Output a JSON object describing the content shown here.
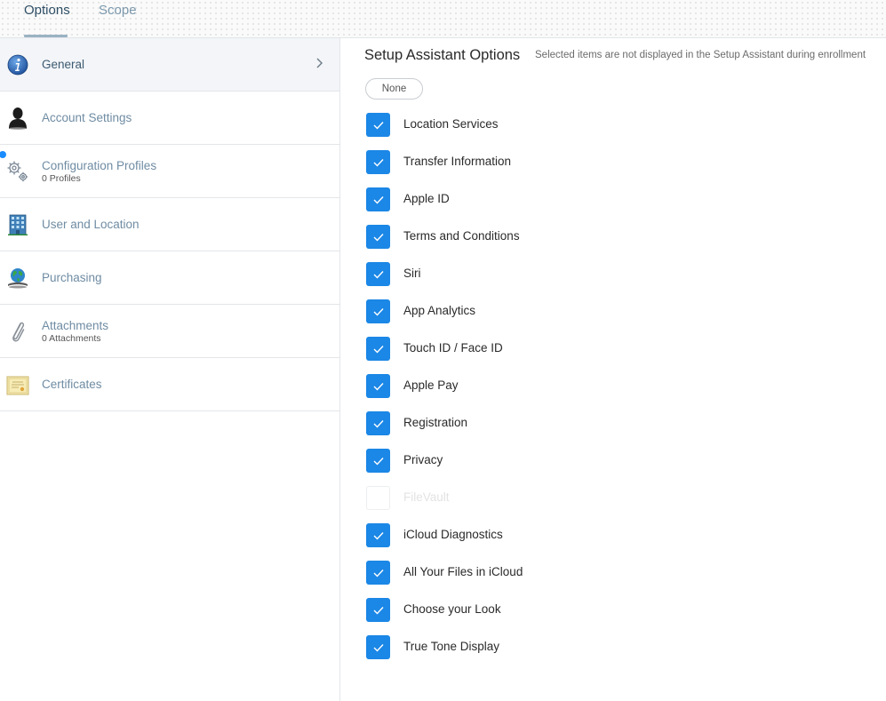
{
  "tabs": [
    {
      "label": "Options",
      "active": true
    },
    {
      "label": "Scope",
      "active": false
    }
  ],
  "sidebar": {
    "items": [
      {
        "label": "General",
        "sub": "",
        "icon": "info-icon",
        "active": true
      },
      {
        "label": "Account Settings",
        "sub": "",
        "icon": "user-silhouette-icon",
        "active": false
      },
      {
        "label": "Configuration Profiles",
        "sub": "0 Profiles",
        "icon": "gears-icon",
        "active": false
      },
      {
        "label": "User and Location",
        "sub": "",
        "icon": "building-icon",
        "active": false
      },
      {
        "label": "Purchasing",
        "sub": "",
        "icon": "globe-icon",
        "active": false
      },
      {
        "label": "Attachments",
        "sub": "0 Attachments",
        "icon": "paperclip-icon",
        "active": false
      },
      {
        "label": "Certificates",
        "sub": "",
        "icon": "certificate-icon",
        "active": false
      }
    ]
  },
  "main": {
    "title": "Setup Assistant Options",
    "hint": "Selected items are not displayed in the Setup Assistant during enrollment",
    "none_label": "None",
    "options": [
      {
        "label": "Location Services",
        "checked": true,
        "enabled": true
      },
      {
        "label": "Transfer Information",
        "checked": true,
        "enabled": true
      },
      {
        "label": "Apple ID",
        "checked": true,
        "enabled": true
      },
      {
        "label": "Terms and Conditions",
        "checked": true,
        "enabled": true
      },
      {
        "label": "Siri",
        "checked": true,
        "enabled": true
      },
      {
        "label": "App Analytics",
        "checked": true,
        "enabled": true
      },
      {
        "label": "Touch ID / Face ID",
        "checked": true,
        "enabled": true
      },
      {
        "label": "Apple Pay",
        "checked": true,
        "enabled": true
      },
      {
        "label": "Registration",
        "checked": true,
        "enabled": true
      },
      {
        "label": "Privacy",
        "checked": true,
        "enabled": true
      },
      {
        "label": "FileVault",
        "checked": false,
        "enabled": false
      },
      {
        "label": "iCloud Diagnostics",
        "checked": true,
        "enabled": true
      },
      {
        "label": "All Your Files in iCloud",
        "checked": true,
        "enabled": true
      },
      {
        "label": "Choose your Look",
        "checked": true,
        "enabled": true
      },
      {
        "label": "True Tone Display",
        "checked": true,
        "enabled": true
      }
    ]
  },
  "colors": {
    "accent": "#1b87e6",
    "sidebar_label": "#6f8ca3",
    "notification_dot": "#1a8cff"
  }
}
